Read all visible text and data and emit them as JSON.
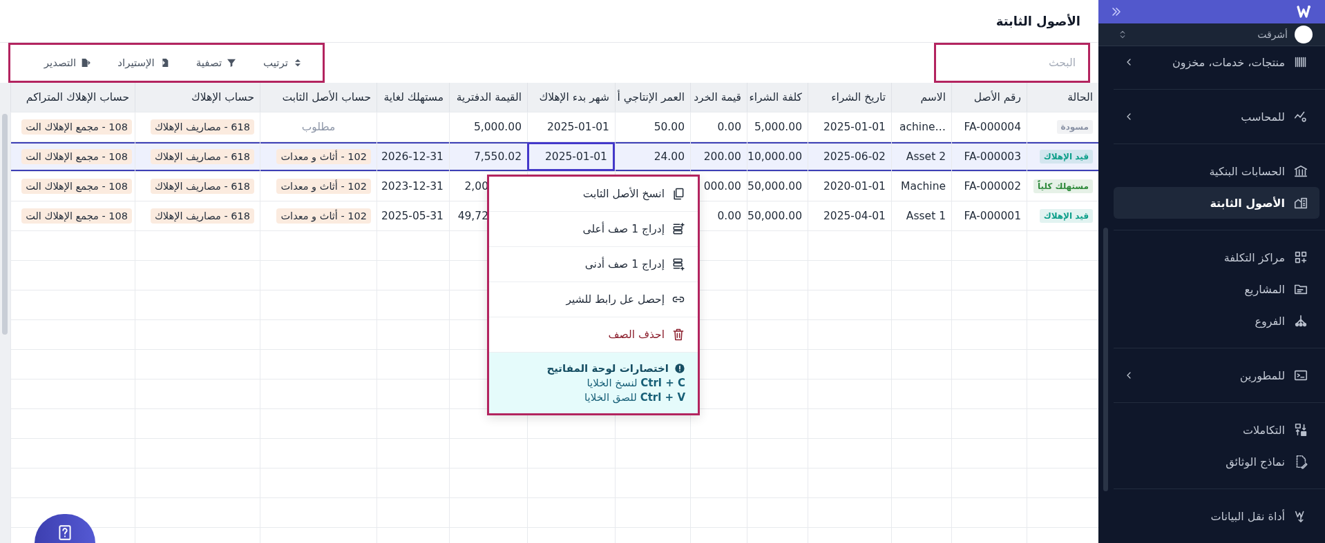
{
  "page": {
    "title": "الأصول الثابتة"
  },
  "toolbar": {
    "search": {
      "placeholder": "البحث"
    },
    "actions": [
      {
        "label": "ترتيب"
      },
      {
        "label": "تصفية"
      },
      {
        "label": "الإستيراد"
      },
      {
        "label": "التصدير"
      }
    ]
  },
  "table": {
    "columns": [
      "الحالة",
      "رقم الأصل",
      "الاسم",
      "تاريخ الشراء",
      "كلفة الشراء",
      "قيمة الخرد",
      "العمر الإنتاجي أ",
      "شهر بدء الإهلاك",
      "القيمة الدفترية",
      "مستهلك لغاية",
      "حساب الأصل الثابت",
      "حساب الإهلاك",
      "حساب الإهلاك المتراكم"
    ],
    "rows": [
      {
        "selected": false,
        "cells": [
          {
            "kind": "status",
            "text": "مسودة",
            "color": "#8a93a6",
            "focused": false
          },
          {
            "kind": "text",
            "text": "FA-000004",
            "focused": false
          },
          {
            "kind": "text",
            "text": "…achine",
            "focused": false
          },
          {
            "kind": "text",
            "text": "2025-01-01",
            "focused": false
          },
          {
            "kind": "text",
            "text": "5,000.00",
            "focused": false
          },
          {
            "kind": "text",
            "text": "0.00",
            "focused": false
          },
          {
            "kind": "text",
            "text": "50.00",
            "focused": false
          },
          {
            "kind": "text",
            "text": "2025-01-01",
            "focused": false
          },
          {
            "kind": "text",
            "text": "5,000.00",
            "focused": false
          },
          {
            "kind": "empty",
            "focused": false
          },
          {
            "kind": "placeholder",
            "text": "مطلوب",
            "focused": false
          },
          {
            "kind": "tag",
            "text": "618 - مصاريف الإهلاك",
            "focused": false
          },
          {
            "kind": "tag",
            "text": "108 - مجمع الإهلاك الت",
            "focused": false
          }
        ]
      },
      {
        "selected": true,
        "cells": [
          {
            "kind": "status",
            "text": "قيد الإهلاك",
            "color": "#0e9f8a",
            "focused": false
          },
          {
            "kind": "text",
            "text": "FA-000003",
            "focused": false
          },
          {
            "kind": "text",
            "text": "Asset 2",
            "focused": false
          },
          {
            "kind": "text",
            "text": "2025-06-02",
            "focused": false
          },
          {
            "kind": "text",
            "text": "10,000.00",
            "focused": false
          },
          {
            "kind": "text",
            "text": "200.00",
            "focused": false
          },
          {
            "kind": "text",
            "text": "24.00",
            "focused": false
          },
          {
            "kind": "text",
            "text": "2025-01-01",
            "focused": true
          },
          {
            "kind": "text",
            "text": "7,550.02",
            "focused": false
          },
          {
            "kind": "text",
            "text": "2026-12-31",
            "focused": false
          },
          {
            "kind": "tag",
            "text": "102 - أثاث و معدات",
            "focused": false
          },
          {
            "kind": "tag",
            "text": "618 - مصاريف الإهلاك",
            "focused": false
          },
          {
            "kind": "tag",
            "text": "108 - مجمع الإهلاك الت",
            "focused": false
          }
        ]
      },
      {
        "selected": false,
        "cells": [
          {
            "kind": "status",
            "text": "مستهلك كلياً",
            "color": "#2f8a3c",
            "focused": false
          },
          {
            "kind": "text",
            "text": "FA-000002",
            "focused": false
          },
          {
            "kind": "text",
            "text": "Machine",
            "focused": false
          },
          {
            "kind": "text",
            "text": "2020-01-01",
            "focused": false
          },
          {
            "kind": "text",
            "text": "50,000.00",
            "focused": false
          },
          {
            "kind": "text",
            "text": "000.00",
            "focused": false
          },
          {
            "kind": "empty",
            "focused": false
          },
          {
            "kind": "empty",
            "focused": false
          },
          {
            "kind": "cut",
            "text": "2,00",
            "focused": false
          },
          {
            "kind": "text",
            "text": "2023-12-31",
            "focused": false
          },
          {
            "kind": "tag",
            "text": "102 - أثاث و معدات",
            "focused": false
          },
          {
            "kind": "tag",
            "text": "618 - مصاريف الإهلاك",
            "focused": false
          },
          {
            "kind": "tag",
            "text": "108 - مجمع الإهلاك الت",
            "focused": false
          }
        ]
      },
      {
        "selected": false,
        "cells": [
          {
            "kind": "status",
            "text": "قيد الإهلاك",
            "color": "#0e9f8a",
            "focused": false
          },
          {
            "kind": "text",
            "text": "FA-000001",
            "focused": false
          },
          {
            "kind": "text",
            "text": "Asset 1",
            "focused": false
          },
          {
            "kind": "text",
            "text": "2025-04-01",
            "focused": false
          },
          {
            "kind": "text",
            "text": "50,000.00",
            "focused": false
          },
          {
            "kind": "text",
            "text": "0.00",
            "focused": false
          },
          {
            "kind": "empty"
          },
          {
            "kind": "empty"
          },
          {
            "kind": "cut",
            "text": "49,72",
            "focused": false
          },
          {
            "kind": "text",
            "text": "2025-05-31",
            "focused": false
          },
          {
            "kind": "tag",
            "text": "102 - أثاث و معدات",
            "focused": false
          },
          {
            "kind": "tag",
            "text": "618 - مصاريف الإهلاك",
            "focused": false
          },
          {
            "kind": "tag",
            "text": "108 - مجمع الإهلاك الت",
            "focused": false
          }
        ]
      }
    ]
  },
  "context_menu": {
    "items": [
      {
        "label": "انسخ الأصل الثابت",
        "kind": "normal"
      },
      {
        "label": "إدراج 1 صف أعلى",
        "kind": "normal"
      },
      {
        "label": "إدراج 1 صف أدنى",
        "kind": "normal"
      },
      {
        "label": "إحصل عل رابط للشير",
        "kind": "normal"
      },
      {
        "label": "احذف الصف",
        "kind": "danger"
      }
    ],
    "hint": {
      "title": "اختصارات لوحة المفاتيح",
      "lines": [
        "**Ctrl + C** لنسخ الخلايا",
        "**Ctrl + V** للصق الخلايا"
      ]
    }
  },
  "sidebar": {
    "org": {
      "name": "أشرقت"
    },
    "groups": [
      {
        "items": [
          {
            "label": "منتجات، خدمات، مخزون",
            "expandable": true,
            "selected": false
          }
        ]
      },
      {
        "items": [
          {
            "label": "للمحاسب",
            "expandable": true,
            "selected": false
          }
        ]
      },
      {
        "items": [
          {
            "label": "الحسابات البنكية",
            "expandable": false,
            "selected": false
          },
          {
            "label": "الأصول الثابتة",
            "expandable": false,
            "selected": true
          }
        ]
      },
      {
        "items": [
          {
            "label": "مراكز التكلفة",
            "expandable": false,
            "selected": false
          },
          {
            "label": "المشاريع",
            "expandable": false,
            "selected": false
          },
          {
            "label": "الفروع",
            "expandable": false,
            "selected": false
          }
        ]
      },
      {
        "items": [
          {
            "label": "للمطورين",
            "expandable": true,
            "selected": false
          }
        ]
      },
      {
        "items": [
          {
            "label": "التكاملات",
            "expandable": false,
            "selected": false
          },
          {
            "label": "نماذج الوثائق",
            "expandable": false,
            "selected": false
          }
        ]
      },
      {
        "items": [
          {
            "label": "أداة نقل البيانات",
            "expandable": false,
            "selected": false
          }
        ]
      }
    ]
  }
}
